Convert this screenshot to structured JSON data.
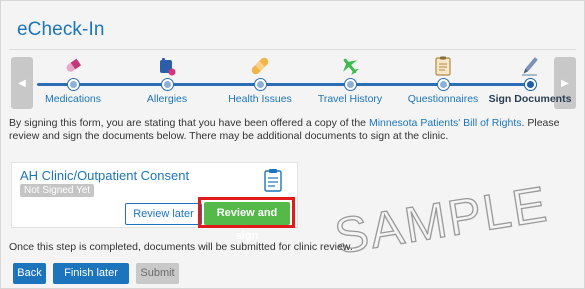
{
  "page": {
    "title": "eCheck-In"
  },
  "stepper": {
    "steps": [
      {
        "label": "Medications",
        "icon": "pills-icon"
      },
      {
        "label": "Allergies",
        "icon": "allergy-icon"
      },
      {
        "label": "Health Issues",
        "icon": "bandage-icon"
      },
      {
        "label": "Travel History",
        "icon": "airplane-icon"
      },
      {
        "label": "Questionnaires",
        "icon": "clipboard-icon"
      },
      {
        "label": "Sign Documents",
        "icon": "pen-icon"
      }
    ],
    "active_step": "Sign Documents"
  },
  "intro": {
    "text_before": "By signing this form, you are stating that you have been offered a copy of the ",
    "link": "Minnesota Patients' Bill of Rights",
    "text_after": ". Please review and sign the documents below. There may be additional documents to sign at the clinic."
  },
  "document": {
    "title": "AH Clinic/Outpatient Consent",
    "status": "Not Signed Yet",
    "review_later_label": "Review later",
    "review_sign_label": "Review and sign"
  },
  "watermark": {
    "text": "SAMPLE"
  },
  "footnote": "Once this step is completed, documents will be submitted for clinic review.",
  "actions": {
    "back_label": "Back",
    "finish_later_label": "Finish later",
    "submit_label": "Submit"
  },
  "colors": {
    "link_blue": "#1c75bc",
    "primary_button": "#1c75bc",
    "review_sign_green": "#55b94a",
    "highlight_red": "#e11b1b",
    "disabled_gray": "#c9c9c9"
  }
}
